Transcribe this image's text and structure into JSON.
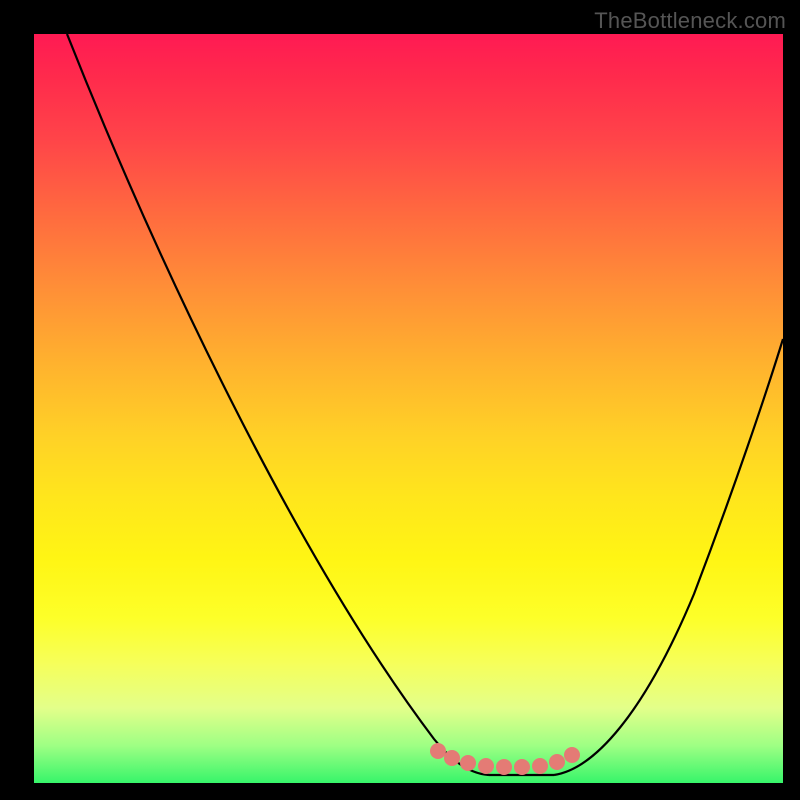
{
  "watermark": {
    "text": "TheBottleneck.com"
  },
  "gradient": {
    "stops": [
      {
        "pct": 0,
        "hex": "#ff1a53"
      },
      {
        "pct": 6,
        "hex": "#ff2b4c"
      },
      {
        "pct": 14,
        "hex": "#ff4449"
      },
      {
        "pct": 24,
        "hex": "#ff6a3f"
      },
      {
        "pct": 34,
        "hex": "#ff8f37"
      },
      {
        "pct": 44,
        "hex": "#ffb22e"
      },
      {
        "pct": 54,
        "hex": "#ffd226"
      },
      {
        "pct": 62,
        "hex": "#ffe61c"
      },
      {
        "pct": 70,
        "hex": "#fff514"
      },
      {
        "pct": 78,
        "hex": "#fdff29"
      },
      {
        "pct": 84,
        "hex": "#f6ff5a"
      },
      {
        "pct": 90,
        "hex": "#e3ff8a"
      },
      {
        "pct": 95,
        "hex": "#9eff84"
      },
      {
        "pct": 100,
        "hex": "#37f56a"
      }
    ]
  },
  "colors": {
    "frame": "#000000",
    "curve": "#000000",
    "marker": "#e47b75"
  },
  "chart_data": {
    "type": "line",
    "title": "",
    "xlabel": "",
    "ylabel": "",
    "x_range_pct": [
      0,
      100
    ],
    "y_range_pct": [
      0,
      100
    ],
    "note": "Axes are unlabeled; values are read as percentages of plot width (x) and height (y), where y=0 is the top of the colored area and y=100 is the bottom.",
    "series": [
      {
        "name": "left-branch",
        "x": [
          4.4,
          15,
          25,
          35,
          45,
          53,
          58,
          60.7
        ],
        "y": [
          0,
          28,
          50,
          70,
          86,
          94,
          98,
          99
        ]
      },
      {
        "name": "trough",
        "x": [
          60.7,
          69.4
        ],
        "y": [
          99,
          99
        ]
      },
      {
        "name": "right-branch",
        "x": [
          69.4,
          76,
          83,
          90,
          96,
          100
        ],
        "y": [
          99,
          95,
          85,
          70,
          52,
          41
        ]
      }
    ],
    "markers": {
      "name": "optimal-zone",
      "color": "#e47b75",
      "x": [
        52.9,
        54.7,
        56.9,
        59.3,
        61.7,
        64.1,
        66.5,
        68.8,
        70.8
      ],
      "y": [
        97.9,
        98.8,
        99.5,
        99.9,
        100,
        100,
        99.9,
        99.3,
        98.4
      ]
    }
  }
}
